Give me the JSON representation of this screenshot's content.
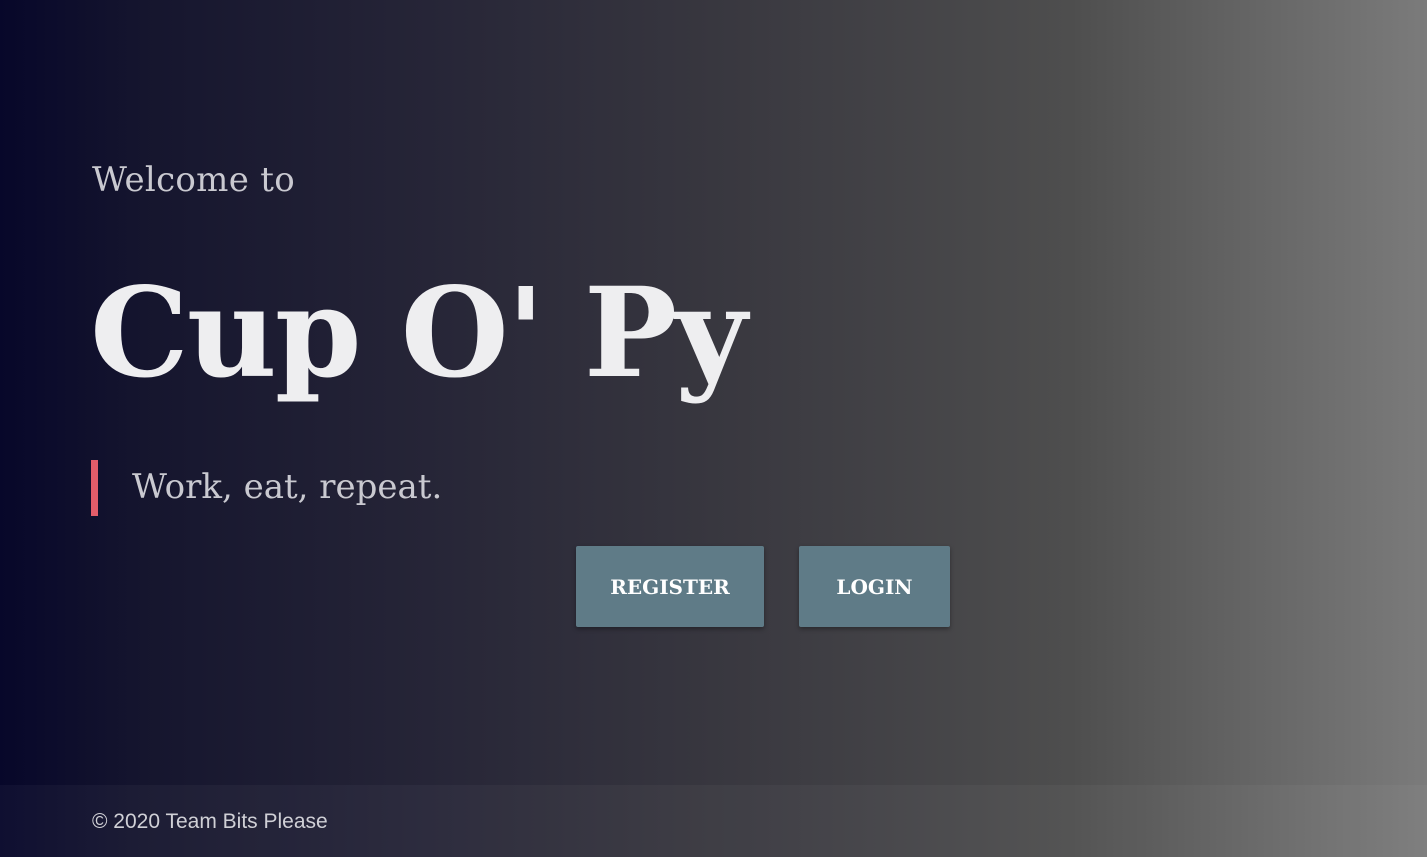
{
  "hero": {
    "welcome_text": "Welcome to",
    "app_title": "Cup O' Py",
    "tagline": "Work, eat, repeat."
  },
  "actions": {
    "register_label": "REGISTER",
    "login_label": "LOGIN"
  },
  "footer": {
    "copyright": "© 2020 Team Bits Please"
  },
  "colors": {
    "accent_bar": "#e35d6a",
    "button_bg": "#5f7b87"
  }
}
